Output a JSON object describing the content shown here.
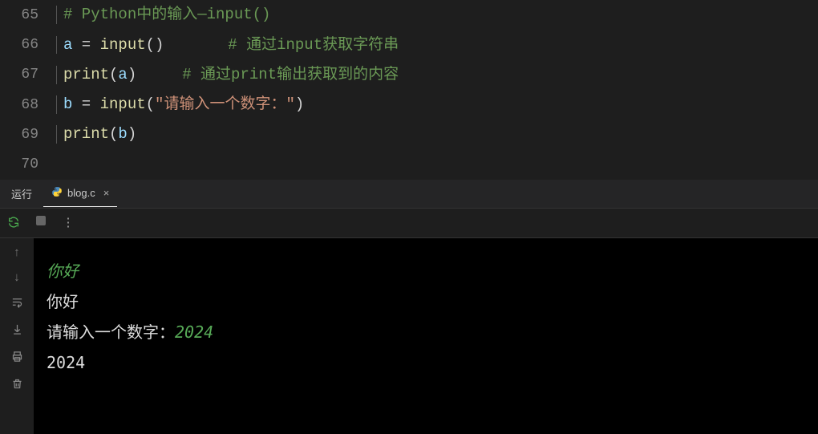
{
  "editor": {
    "lines": [
      {
        "num": "65"
      },
      {
        "num": "66"
      },
      {
        "num": "67"
      },
      {
        "num": "68"
      },
      {
        "num": "69"
      },
      {
        "num": "70"
      }
    ],
    "l65_comment": "# Python中的输入—input()",
    "l66_var": "a",
    "l66_eq": " = ",
    "l66_fn": "input",
    "l66_paren": "()",
    "l66_pad": "       ",
    "l66_comment": "# 通过input获取字符串",
    "l67_fn": "print",
    "l67_open": "(",
    "l67_arg": "a",
    "l67_close": ")",
    "l67_pad": "     ",
    "l67_comment": "# 通过print输出获取到的内容",
    "l68_var": "b",
    "l68_eq": " = ",
    "l68_fn": "input",
    "l68_open": "(",
    "l68_str": "\"请输入一个数字：\"",
    "l68_close": ")",
    "l69_fn": "print",
    "l69_open": "(",
    "l69_arg": "b",
    "l69_close": ")"
  },
  "panel": {
    "run_label": "运行",
    "tab_label": "blog.c",
    "tab_close": "×"
  },
  "console": {
    "in1": "你好",
    "out1": "你好",
    "prompt2": "请输入一个数字：",
    "in2": "2024",
    "out2": "2024"
  }
}
